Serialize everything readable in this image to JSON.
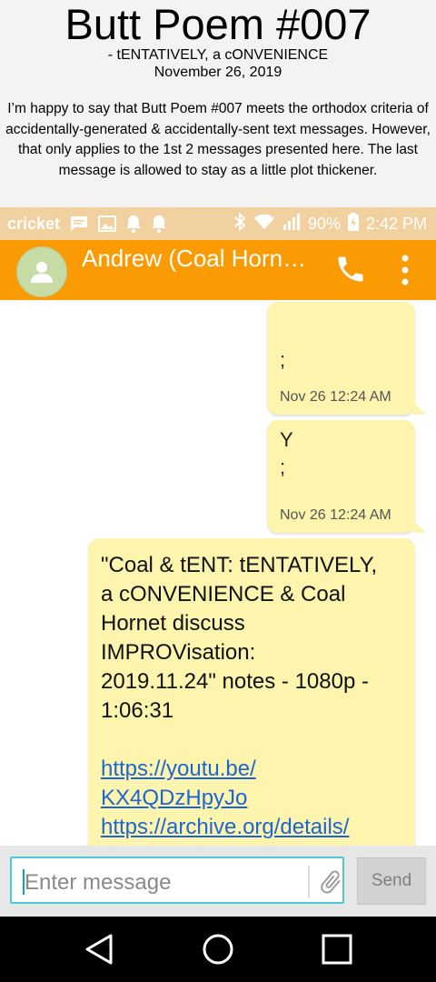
{
  "header": {
    "title": "Butt Poem #007",
    "subtitle": "- tENTATIVELY, a cONVENIENCE",
    "date": "November 26, 2019",
    "description": "I’m happy to say that Butt Poem #007 meets the orthodox criteria of accidentally-generated & accidentally-sent text messages.  However, that only applies to the 1st 2 messages presented here.  The last message is allowed to stay as a little plot thickener."
  },
  "status_bar": {
    "carrier": "cricket",
    "battery": "90%",
    "time": "2:42 PM",
    "icons": [
      "message-icon",
      "image-icon",
      "bell-icon",
      "bell-icon",
      "bluetooth-icon",
      "wifi-icon",
      "signal-icon",
      "battery-icon"
    ]
  },
  "app_bar": {
    "contact_name": "Andrew (Coal Horn…",
    "icons": [
      "avatar-icon",
      "phone-icon",
      "more-vert-icon"
    ]
  },
  "messages": [
    {
      "text": ";",
      "time": "Nov 26 12:24 AM"
    },
    {
      "line1": "Y",
      "line2": ";",
      "time": "Nov 26 12:24 AM"
    },
    {
      "text_lines": [
        "\"Coal & tENT: tENTATIVELY,",
        "a cONVENIENCE & Coal",
        "Hornet discuss",
        "IMPROVisation:",
        "2019.11.24\" notes - 1080p -",
        "1:06:31"
      ],
      "link1_lines": [
        "https://youtu.be/",
        "KX4QDzHpyJo"
      ],
      "link2": "https://archive.org/details/"
    }
  ],
  "composer": {
    "placeholder": "Enter message",
    "send_label": "Send"
  },
  "colors": {
    "app_bar": "#fb9b04",
    "status_bar": "#f1d1a0",
    "bubble": "#fdf4ae",
    "input_border": "#4fc6d6"
  }
}
